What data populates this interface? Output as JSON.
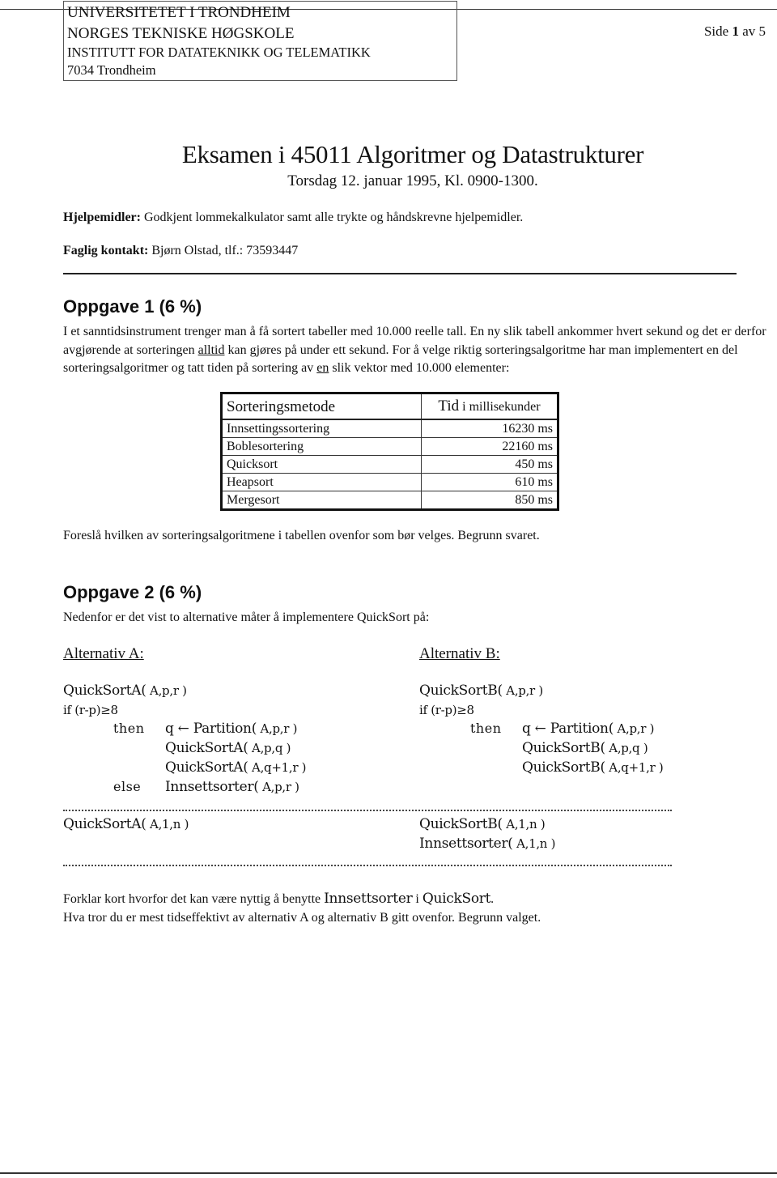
{
  "header": {
    "institution_lines": [
      "UNIVERSITETET I TRONDHEIM",
      "NORGES TEKNISKE HØGSKOLE",
      "INSTITUTT FOR DATATEKNIKK OG TELEMATIKK",
      "7034 Trondheim"
    ],
    "page_prefix": "Side",
    "page_current": "1",
    "page_of": "av 5"
  },
  "exam": {
    "title": "Eksamen i 45011 Algoritmer og Datastrukturer",
    "subtitle": "Torsdag 12. januar 1995, Kl. 0900-1300.",
    "aids_label": "Hjelpemidler:",
    "aids_text": " Godkjent lommekalkulator samt alle trykte og håndskrevne hjelpemidler.",
    "contact_label": "Faglig kontakt:",
    "contact_text": " Bjørn Olstad, tlf.: 73593447"
  },
  "task1": {
    "heading": "Oppgave 1 (6 %)",
    "p1_a": "I et sanntidsinstrument trenger man å få sortert tabeller med 10.000 reelle tall. En ny slik tabell ankommer hvert sekund og det er derfor avgjørende at sorteringen ",
    "p1_u1": "alltid",
    "p1_b": " kan gjøres på under ett sekund. For å velge riktig sorteringsalgoritme har man implementert en del sorteringsalgoritmer og tatt tiden på sortering av ",
    "p1_u2": "en",
    "p1_c": " slik vektor med 10.000 elementer:",
    "table": {
      "col1_header": "Sorteringsmetode",
      "col2_header_main": "Tid",
      "col2_header_small": " i millisekunder",
      "rows": [
        {
          "method": "Innsettingssortering",
          "time": "16230 ms"
        },
        {
          "method": "Boblesortering",
          "time": "22160 ms"
        },
        {
          "method": "Quicksort",
          "time": "450 ms"
        },
        {
          "method": "Heapsort",
          "time": "610 ms"
        },
        {
          "method": "Mergesort",
          "time": "850 ms"
        }
      ]
    },
    "question": "Foreslå hvilken av sorteringsalgoritmene i tabellen ovenfor som bør velges. Begrunn svaret."
  },
  "task2": {
    "heading": "Oppgave 2 (6 %)",
    "intro": "Nedenfor er det vist to alternative måter å implementere QuickSort på:",
    "alt_a": {
      "label": "Alternativ A:",
      "sig_name": "QuickSortA(",
      "sig_args": " A,p,r )",
      "cond": "if (r-p)≥8",
      "then_kw": "then",
      "then_lines": [
        {
          "name": "q ← Partition(",
          "args": " A,p,r )"
        },
        {
          "name": "QuickSortA(",
          "args": " A,p,q )"
        },
        {
          "name": "QuickSortA(",
          "args": " A,q+1,r )"
        }
      ],
      "else_kw": "else",
      "else_line": {
        "name": "Innsettsorter(",
        "args": " A,p,r )"
      },
      "call": {
        "name": "QuickSortA(",
        "args": " A,1,n )"
      }
    },
    "alt_b": {
      "label": "Alternativ B:",
      "sig_name": "QuickSortB(",
      "sig_args": " A,p,r )",
      "cond": "if (r-p)≥8",
      "then_kw": "then",
      "then_lines": [
        {
          "name": "q ← Partition(",
          "args": " A,p,r )"
        },
        {
          "name": "QuickSortB(",
          "args": " A,p,q )"
        },
        {
          "name": "QuickSortB(",
          "args": " A,q+1,r )"
        }
      ],
      "calls": [
        {
          "name": "QuickSortB(",
          "args": " A,1,n )"
        },
        {
          "name": "Innsettsorter(",
          "args": " A,1,n )"
        }
      ]
    },
    "q1_a": "Forklar kort hvorfor det kan være nyttig å benytte ",
    "q1_code1": "Innsettsorter",
    "q1_b": " i ",
    "q1_code2": "QuickSort",
    "q1_c": ".",
    "q2": "Hva tror du er mest tidseffektivt av alternativ A og alternativ B gitt ovenfor. Begrunn valget."
  }
}
